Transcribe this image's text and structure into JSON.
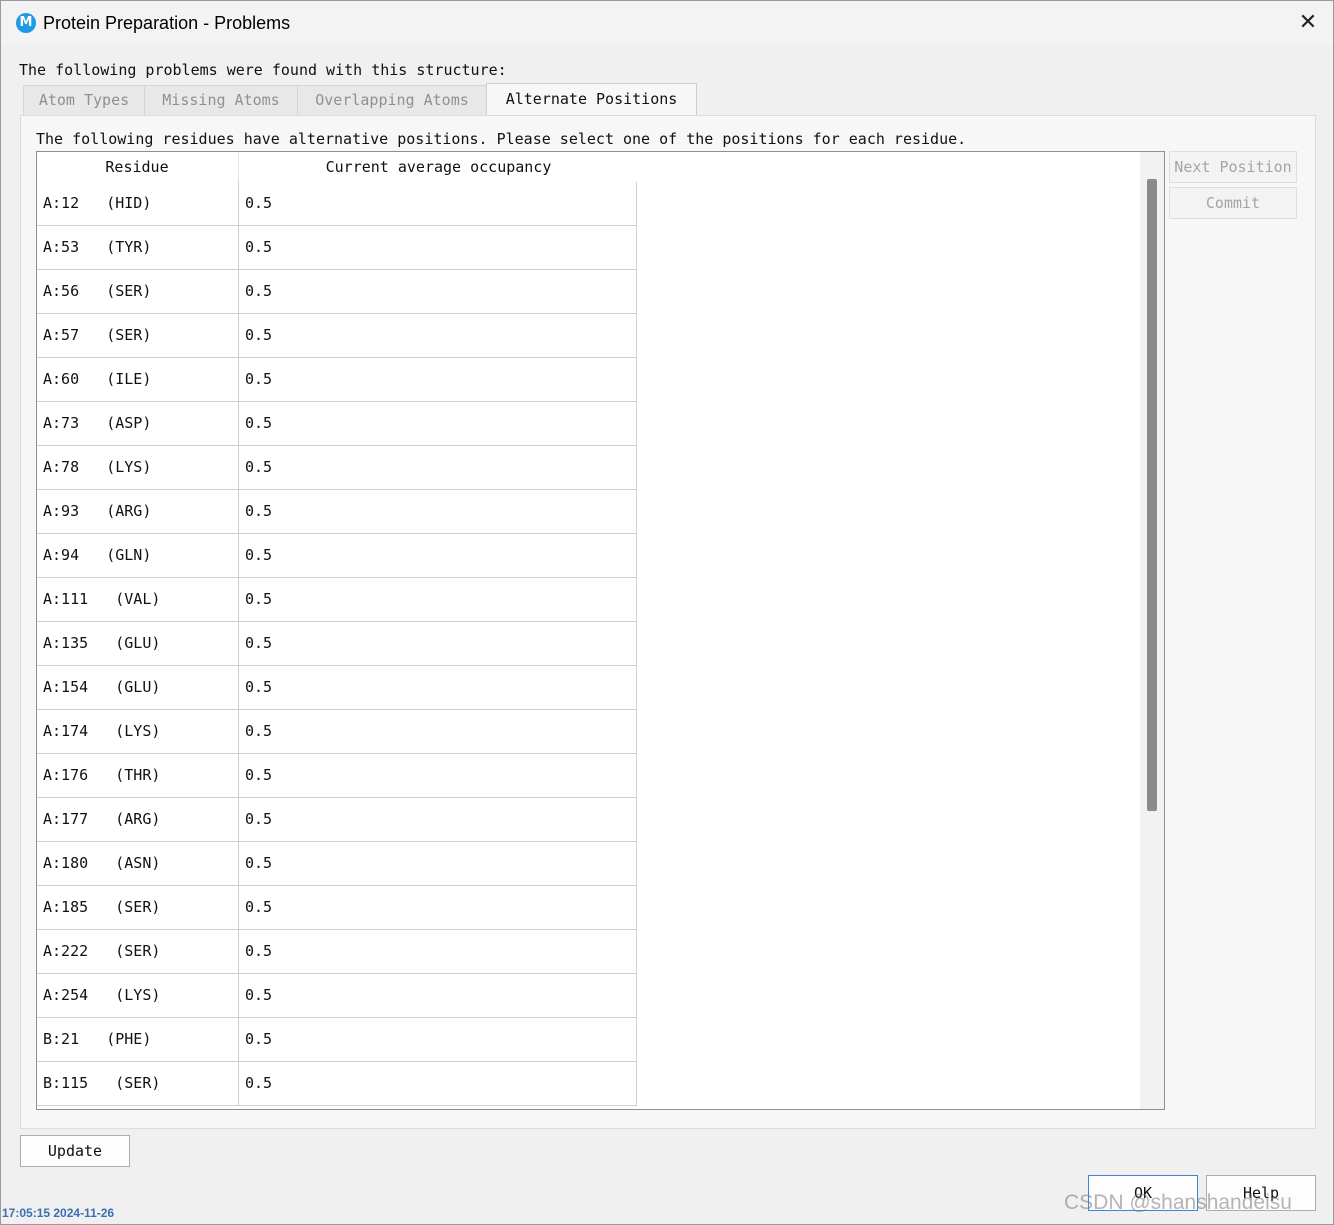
{
  "window": {
    "title": "Protein Preparation - Problems"
  },
  "intro_text": "The following problems were found with this structure:",
  "tabs": [
    {
      "label": "Atom Types",
      "active": false
    },
    {
      "label": "Missing Atoms",
      "active": false
    },
    {
      "label": "Overlapping Atoms",
      "active": false
    },
    {
      "label": "Alternate Positions",
      "active": true
    }
  ],
  "panel": {
    "description": "The following residues have alternative positions. Please select one of the positions for each residue.",
    "columns": [
      "Residue",
      "Current average occupancy"
    ],
    "rows": [
      {
        "residue": "A:12   (HID)",
        "occupancy": "0.5"
      },
      {
        "residue": "A:53   (TYR)",
        "occupancy": "0.5"
      },
      {
        "residue": "A:56   (SER)",
        "occupancy": "0.5"
      },
      {
        "residue": "A:57   (SER)",
        "occupancy": "0.5"
      },
      {
        "residue": "A:60   (ILE)",
        "occupancy": "0.5"
      },
      {
        "residue": "A:73   (ASP)",
        "occupancy": "0.5"
      },
      {
        "residue": "A:78   (LYS)",
        "occupancy": "0.5"
      },
      {
        "residue": "A:93   (ARG)",
        "occupancy": "0.5"
      },
      {
        "residue": "A:94   (GLN)",
        "occupancy": "0.5"
      },
      {
        "residue": "A:111   (VAL)",
        "occupancy": "0.5"
      },
      {
        "residue": "A:135   (GLU)",
        "occupancy": "0.5"
      },
      {
        "residue": "A:154   (GLU)",
        "occupancy": "0.5"
      },
      {
        "residue": "A:174   (LYS)",
        "occupancy": "0.5"
      },
      {
        "residue": "A:176   (THR)",
        "occupancy": "0.5"
      },
      {
        "residue": "A:177   (ARG)",
        "occupancy": "0.5"
      },
      {
        "residue": "A:180   (ASN)",
        "occupancy": "0.5"
      },
      {
        "residue": "A:185   (SER)",
        "occupancy": "0.5"
      },
      {
        "residue": "A:222   (SER)",
        "occupancy": "0.5"
      },
      {
        "residue": "A:254   (LYS)",
        "occupancy": "0.5"
      },
      {
        "residue": "B:21   (PHE)",
        "occupancy": "0.5"
      },
      {
        "residue": "B:115   (SER)",
        "occupancy": "0.5"
      }
    ],
    "next_position_label": "Next Position",
    "commit_label": "Commit"
  },
  "buttons": {
    "update": "Update",
    "ok": "OK",
    "help": "Help"
  },
  "footer": {
    "timestamp": "17:05:15 2024-11-26",
    "watermark": "CSDN @shanshandeisu"
  },
  "colors": {
    "app_icon": "#1e9be6",
    "ok_border": "#3b86d6",
    "timestamp": "#3a6fb2"
  },
  "icons": {
    "app": "maestro-logo-icon",
    "close": "close-icon"
  }
}
